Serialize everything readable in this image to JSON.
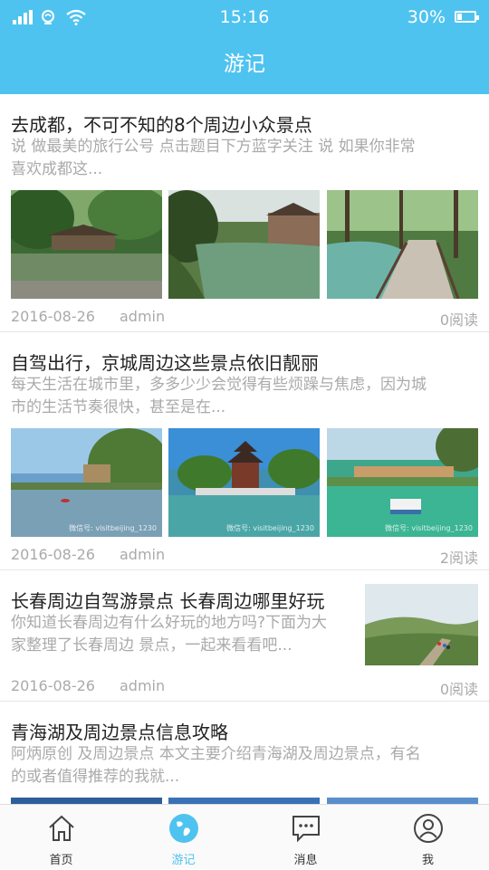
{
  "status_bar": {
    "time": "15:16",
    "battery": "30%",
    "battery_level": 0.3
  },
  "header": {
    "title": "游记"
  },
  "articles": [
    {
      "title": "去成都，不可不知的8个周边小众景点",
      "desc_line1": "说 做最美的旅行公号  点击题目下方蓝字关注   说    如果你非常",
      "desc_line2": "喜欢成都这...",
      "date": "2016-08-26",
      "author": "admin",
      "reads": "0阅读"
    },
    {
      "title": "自驾出行，京城周边这些景点依旧靓丽",
      "desc_line1": "每天生活在城市里，多多少少会觉得有些烦躁与焦虑，因为城",
      "desc_line2": "市的生活节奏很快，甚至是在...",
      "date": "2016-08-26",
      "author": "admin",
      "reads": "2阅读",
      "watermark": "微信号: visitbeijing_1230"
    },
    {
      "title": "长春周边自驾游景点 长春周边哪里好玩",
      "desc_line1": "你知道长春周边有什么好玩的地方吗?下面为大",
      "desc_line2": "家整理了长春周边  景点，一起来看看吧...",
      "date": "2016-08-26",
      "author": "admin",
      "reads": "0阅读"
    },
    {
      "title": "青海湖及周边景点信息攻略",
      "desc_line1": "阿炳原创  及周边景点  本文主要介绍青海湖及周边景点，有名",
      "desc_line2": "的或者值得推荐的我就..."
    }
  ],
  "tabs": [
    {
      "label": "首页",
      "icon": "home-icon"
    },
    {
      "label": "游记",
      "icon": "globe-icon"
    },
    {
      "label": "消息",
      "icon": "message-icon"
    },
    {
      "label": "我",
      "icon": "user-icon"
    }
  ],
  "colors": {
    "accent": "#4fc3f0",
    "muted": "#aaaaaa"
  }
}
